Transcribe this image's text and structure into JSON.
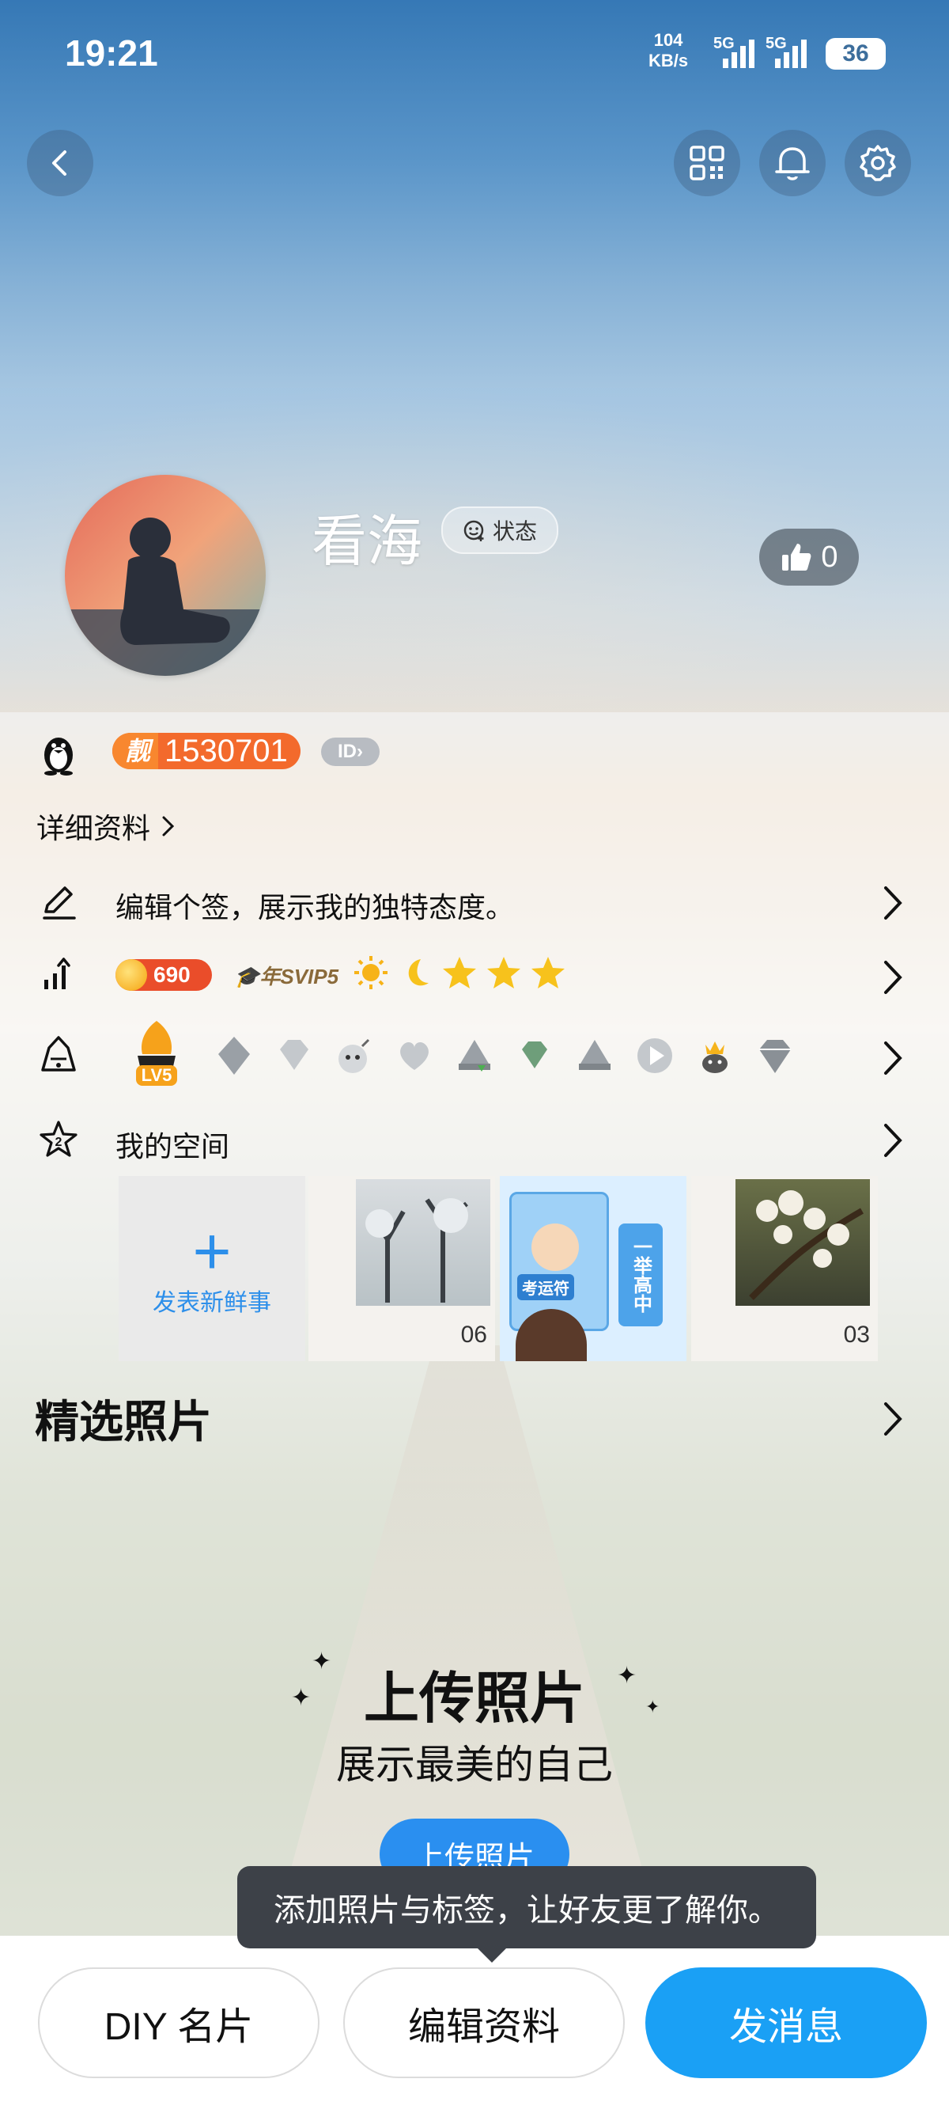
{
  "status_bar": {
    "time": "19:21",
    "net_speed_value": "104",
    "net_speed_unit": "KB/s",
    "sim1": "5G",
    "sim2": "5G",
    "battery": "36"
  },
  "profile": {
    "name": "看海",
    "status_label": "状态",
    "likes": "0",
    "qq_badge_label": "靓",
    "qq_number": "1530701",
    "id_label": "ID",
    "details_link": "详细资料"
  },
  "rows": {
    "signature": "编辑个签，展示我的独特态度。",
    "coins": "690",
    "svip": "年SVIP5",
    "level_badge": "LV5",
    "my_space": "我的空间"
  },
  "space": {
    "new_post_label": "发表新鲜事",
    "thumb_dates": [
      "06",
      "03"
    ],
    "thumb_tags": [
      "考运符",
      "一举高中"
    ]
  },
  "photos": {
    "section_title": "精选照片",
    "upload_title": "上传照片",
    "upload_subtitle": "展示最美的自己",
    "upload_button": "上传照片",
    "tooltip": "添加照片与标签，让好友更了解你。"
  },
  "bottom": {
    "diy_card": "DIY 名片",
    "edit_profile": "编辑资料",
    "send_message": "发消息"
  },
  "colors": {
    "accent": "#1aa0f5",
    "badge_orange": "#f36a2c",
    "tooltip_bg": "#3d4148"
  }
}
